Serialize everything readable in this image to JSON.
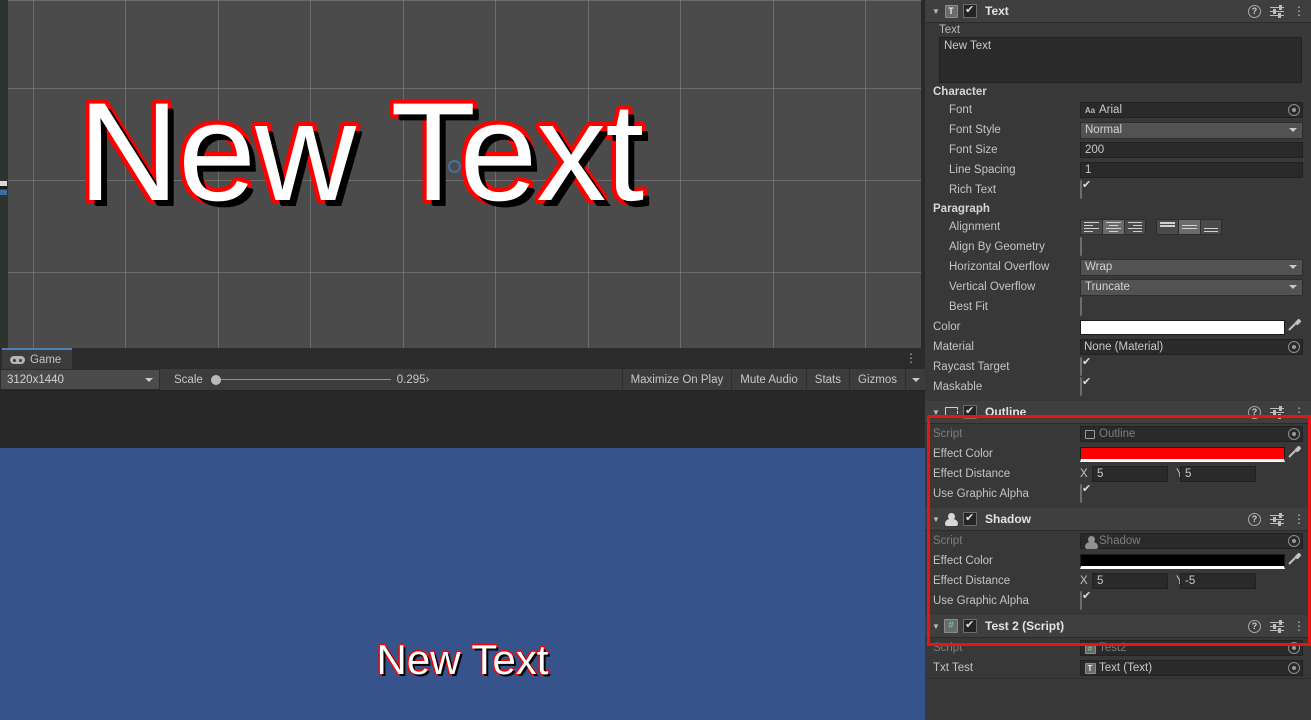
{
  "scene_view": {
    "text": "New Text",
    "gizmo": "pivot-circle-handle"
  },
  "game_panel": {
    "tab": {
      "label": "Game",
      "icon": "gamepad-icon"
    },
    "kebab": "⋮",
    "toolbar": {
      "resolution": "3120x1440",
      "scale_label": "Scale",
      "scale_value": "0.295›",
      "maximize_on_play": "Maximize On Play",
      "mute_audio": "Mute Audio",
      "stats": "Stats",
      "gizmos": "Gizmos"
    },
    "render_text": "New Text",
    "background_color": "#37538b"
  },
  "inspector": {
    "components": [
      {
        "name": "Text",
        "icon": "text-component-icon",
        "enabled": true,
        "header_icons": [
          "help-icon",
          "preset-icon",
          "kebab-icon"
        ],
        "text_label": "Text",
        "text_value": "New Text",
        "character_label": "Character",
        "font_label": "Font",
        "font_value": "Arial",
        "font_style_label": "Font Style",
        "font_style_value": "Normal",
        "font_size_label": "Font Size",
        "font_size_value": "200",
        "line_spacing_label": "Line Spacing",
        "line_spacing_value": "1",
        "rich_text_label": "Rich Text",
        "rich_text_value": true,
        "paragraph_label": "Paragraph",
        "alignment_label": "Alignment",
        "alignment_horizontal_selected": 1,
        "alignment_vertical_selected": 1,
        "align_by_geometry_label": "Align By Geometry",
        "align_by_geometry_value": false,
        "horizontal_overflow_label": "Horizontal Overflow",
        "horizontal_overflow_value": "Wrap",
        "vertical_overflow_label": "Vertical Overflow",
        "vertical_overflow_value": "Truncate",
        "best_fit_label": "Best Fit",
        "best_fit_value": false,
        "color_label": "Color",
        "color_value": "#ffffff",
        "material_label": "Material",
        "material_value": "None (Material)",
        "raycast_target_label": "Raycast Target",
        "raycast_target_value": true,
        "maskable_label": "Maskable",
        "maskable_value": true
      },
      {
        "name": "Outline",
        "icon": "outline-component-icon",
        "enabled": true,
        "script_label": "Script",
        "script_value": "Outline",
        "effect_color_label": "Effect Color",
        "effect_color_value": "#ff0000",
        "effect_distance_label": "Effect Distance",
        "effect_distance_x_label": "X",
        "effect_distance_x": "5",
        "effect_distance_y_label": "Y",
        "effect_distance_y": "5",
        "use_graphic_alpha_label": "Use Graphic Alpha",
        "use_graphic_alpha_value": true
      },
      {
        "name": "Shadow",
        "icon": "shadow-component-icon",
        "enabled": true,
        "script_label": "Script",
        "script_value": "Shadow",
        "effect_color_label": "Effect Color",
        "effect_color_value": "#000000",
        "effect_distance_label": "Effect Distance",
        "effect_distance_x_label": "X",
        "effect_distance_x": "5",
        "effect_distance_y_label": "Y",
        "effect_distance_y": "-5",
        "use_graphic_alpha_label": "Use Graphic Alpha",
        "use_graphic_alpha_value": true
      },
      {
        "name": "Test 2 (Script)",
        "icon": "csharp-script-icon",
        "enabled": true,
        "script_label": "Script",
        "script_value": "Test2",
        "txt_test_label": "Txt Test",
        "txt_test_value": "Text (Text)"
      }
    ],
    "highlight_color": "#e81313"
  }
}
